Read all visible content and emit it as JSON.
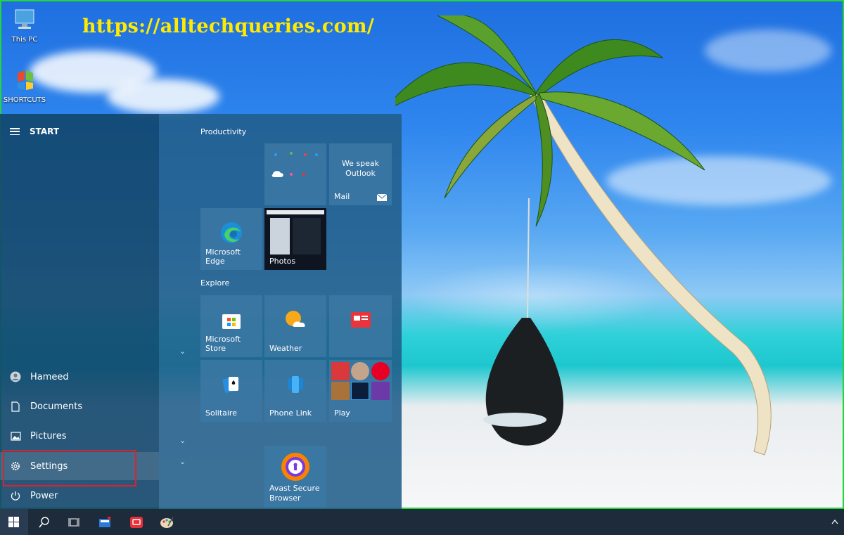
{
  "watermark": "https://alltechqueries.com/",
  "desktop_icons": [
    {
      "label": "This PC",
      "icon": "computer-icon"
    },
    {
      "label": "SHORTCUTS",
      "icon": "shortcuts-icon"
    }
  ],
  "start": {
    "header": "START",
    "side_items": [
      {
        "label": "Hameed",
        "icon": "user-icon"
      },
      {
        "label": "Documents",
        "icon": "document-icon"
      },
      {
        "label": "Pictures",
        "icon": "pictures-icon"
      },
      {
        "label": "Settings",
        "icon": "gear-icon"
      },
      {
        "label": "Power",
        "icon": "power-icon"
      }
    ],
    "groups": {
      "productivity": "Productivity",
      "explore": "Explore"
    },
    "tiles": {
      "mail_top": "We speak Outlook",
      "mail_label": "Mail",
      "edge": "Microsoft Edge",
      "photos": "Photos",
      "store": "Microsoft Store",
      "weather": "Weather",
      "solitaire": "Solitaire",
      "phone_link": "Phone Link",
      "play": "Play",
      "avast_line1": "Avast Secure",
      "avast_line2": "Browser"
    }
  },
  "taskbar": {
    "items": [
      "windows-start-icon",
      "search-icon",
      "task-view-icon",
      "app-icon",
      "feedback-icon",
      "paint-icon"
    ],
    "tray_icon": "chevron-up-icon"
  }
}
